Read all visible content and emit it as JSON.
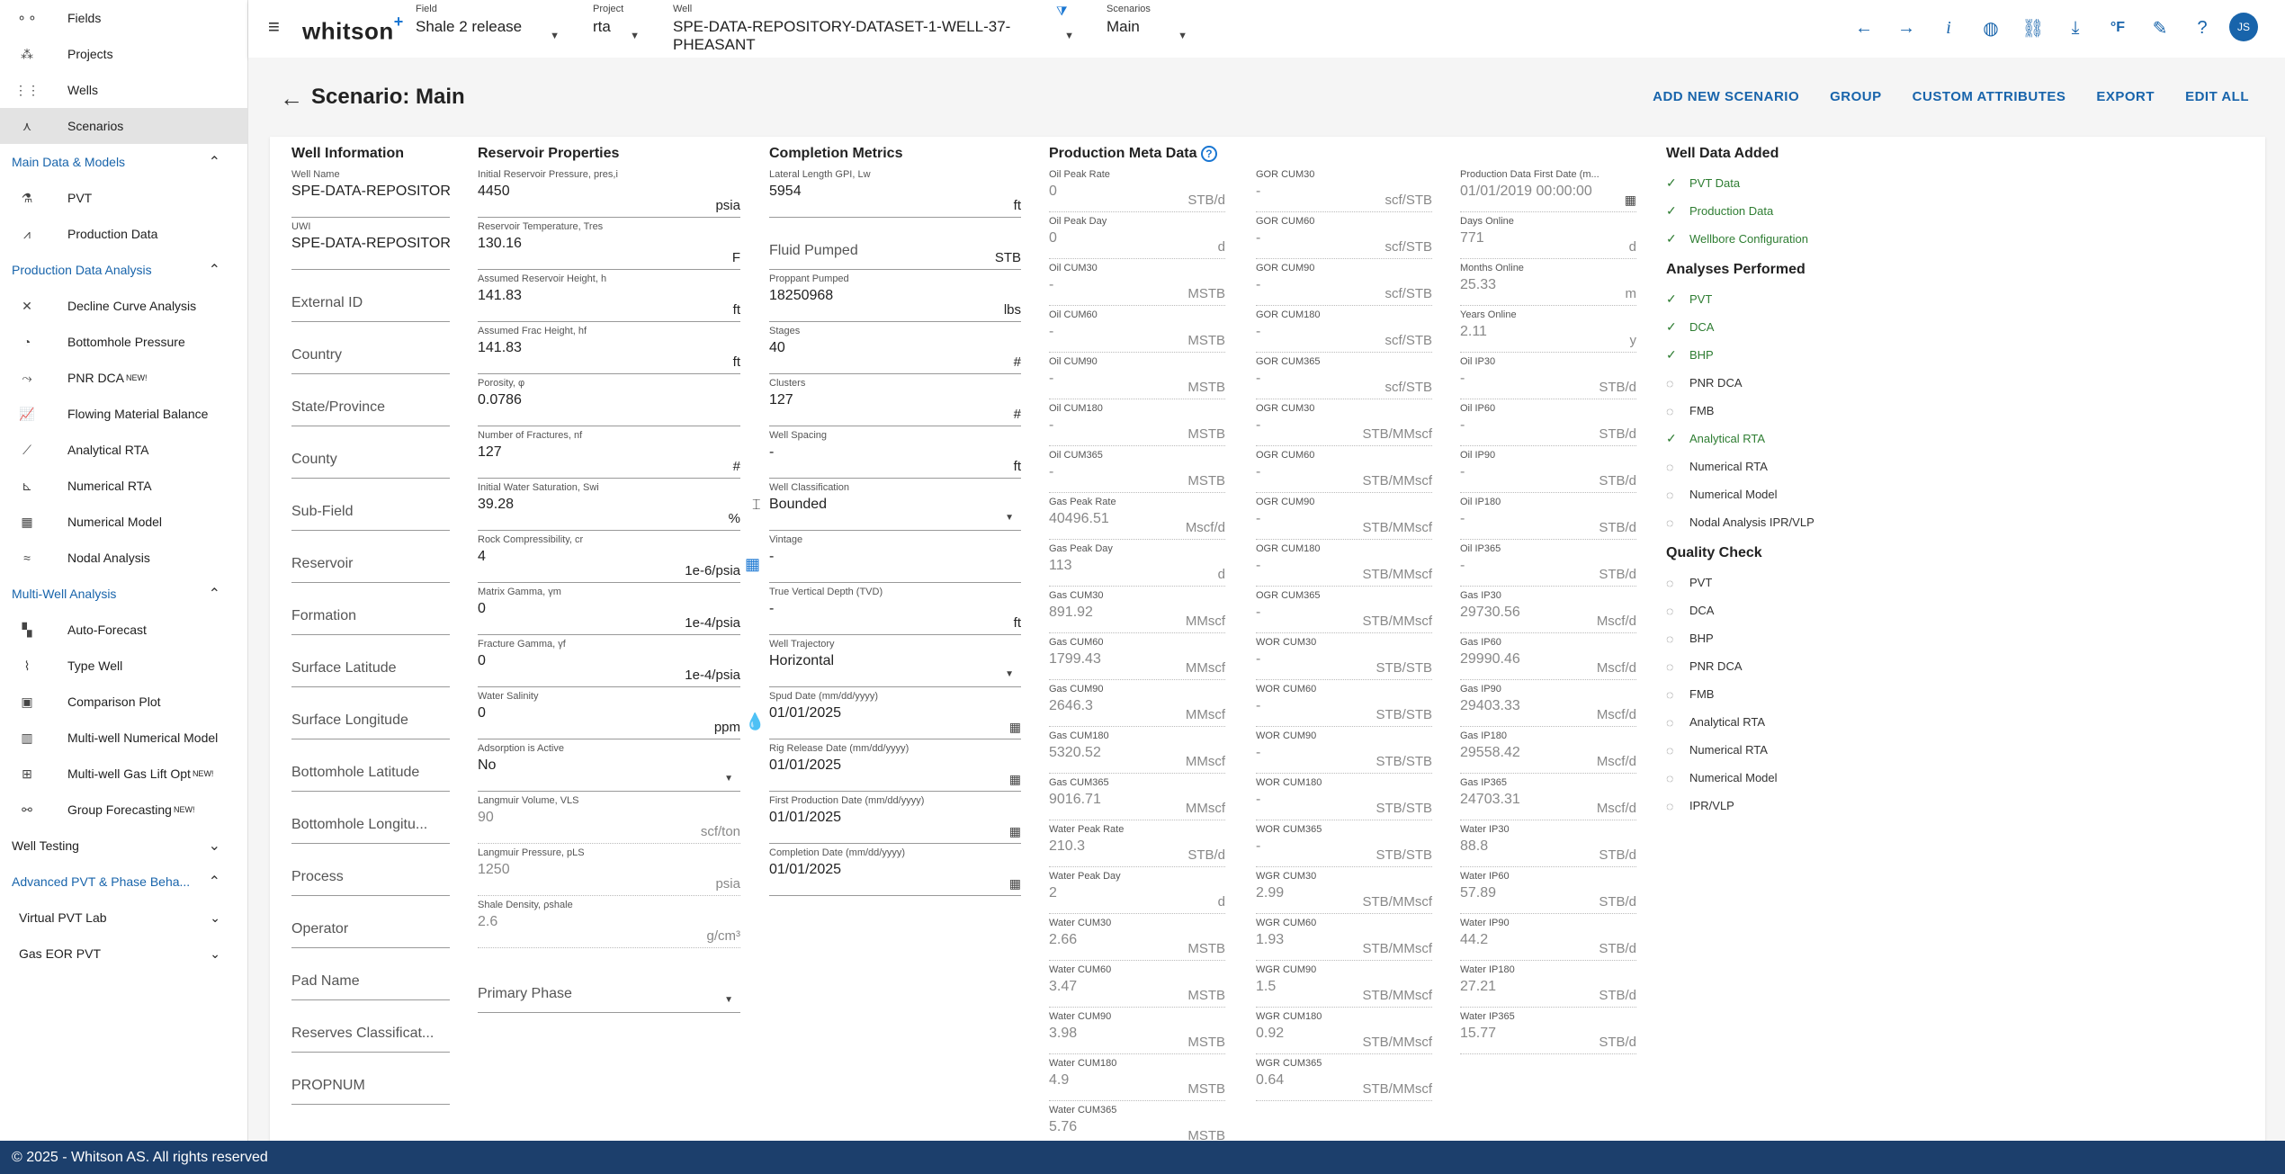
{
  "sidebar": {
    "items": [
      {
        "label": "Fields",
        "icon": "fields-icon",
        "active": false
      },
      {
        "label": "Projects",
        "icon": "projects-icon",
        "active": false
      },
      {
        "label": "Wells",
        "icon": "wells-icon",
        "active": false
      },
      {
        "label": "Scenarios",
        "icon": "scenarios-icon",
        "active": true
      }
    ],
    "sections": [
      {
        "label": "Main Data & Models",
        "items": [
          {
            "label": "PVT",
            "icon": "flask-icon"
          },
          {
            "label": "Production Data",
            "icon": "production-chart-icon"
          }
        ]
      },
      {
        "label": "Production Data Analysis",
        "items": [
          {
            "label": "Decline Curve Analysis",
            "icon": "decline-curve-icon"
          },
          {
            "label": "Bottomhole Pressure",
            "icon": "gauge-icon"
          },
          {
            "label": "PNR DCA",
            "sup": "NEW!",
            "icon": "pnr-dca-icon"
          },
          {
            "label": "Flowing Material Balance",
            "icon": "fmb-chart-icon"
          },
          {
            "label": "Analytical RTA",
            "icon": "analytical-rta-icon"
          },
          {
            "label": "Numerical RTA",
            "icon": "numerical-rta-icon"
          },
          {
            "label": "Numerical Model",
            "icon": "grid-model-icon"
          },
          {
            "label": "Nodal Analysis",
            "icon": "nodal-icon"
          }
        ]
      },
      {
        "label": "Multi-Well Analysis",
        "items": [
          {
            "label": "Auto-Forecast",
            "icon": "auto-forecast-icon"
          },
          {
            "label": "Type Well",
            "icon": "type-well-icon"
          },
          {
            "label": "Comparison Plot",
            "icon": "comparison-plot-icon"
          },
          {
            "label": "Multi-well Numerical Model",
            "icon": "multiwell-model-icon"
          },
          {
            "label": "Multi-well Gas Lift Opt",
            "sup": "NEW!",
            "icon": "gas-lift-icon"
          },
          {
            "label": "Group Forecasting",
            "sup": "NEW!",
            "icon": "group-forecast-icon"
          }
        ]
      }
    ],
    "well_testing": "Well Testing",
    "advanced": "Advanced PVT & Phase Beha...",
    "virtual_pvt": "Virtual PVT Lab",
    "gas_eor": "Gas EOR PVT"
  },
  "footer": "© 2025 - Whitson AS. All rights reserved",
  "topbar": {
    "brand": "whitson",
    "brand_plus": "+",
    "field": {
      "label": "Field",
      "value": "Shale 2 release"
    },
    "project": {
      "label": "Project",
      "value": "rta"
    },
    "well": {
      "label": "Well",
      "value": "SPE-DATA-REPOSITORY-DATASET-1-WELL-37-PHEASANT"
    },
    "scenarios": {
      "label": "Scenarios",
      "value": "Main"
    },
    "avatar": "JS"
  },
  "page": {
    "title": "Scenario: Main",
    "actions": [
      "ADD NEW SCENARIO",
      "GROUP",
      "CUSTOM ATTRIBUTES",
      "EXPORT",
      "EDIT ALL"
    ]
  },
  "well_info": {
    "title": "Well Information",
    "fields": [
      {
        "label": "Well Name",
        "value": "SPE-DATA-REPOSITORY-"
      },
      {
        "label": "UWI",
        "value": "SPE-DATA-REPOSITORY-"
      },
      {
        "label": "",
        "value": "External ID"
      },
      {
        "label": "",
        "value": "Country"
      },
      {
        "label": "",
        "value": "State/Province"
      },
      {
        "label": "",
        "value": "County"
      },
      {
        "label": "",
        "value": "Sub-Field"
      },
      {
        "label": "",
        "value": "Reservoir"
      },
      {
        "label": "",
        "value": "Formation"
      },
      {
        "label": "",
        "value": "Surface Latitude"
      },
      {
        "label": "",
        "value": "Surface Longitude"
      },
      {
        "label": "",
        "value": "Bottomhole Latitude"
      },
      {
        "label": "",
        "value": "Bottomhole Longitu..."
      },
      {
        "label": "",
        "value": "Process"
      },
      {
        "label": "",
        "value": "Operator"
      },
      {
        "label": "",
        "value": "Pad Name"
      },
      {
        "label": "",
        "value": "Reserves Classificat..."
      },
      {
        "label": "",
        "value": "PROPNUM"
      }
    ]
  },
  "reservoir": {
    "title": "Reservoir Properties",
    "fields": [
      {
        "label": "Initial Reservoir Pressure, pres,i",
        "value": "4450",
        "unit": "psia"
      },
      {
        "label": "Reservoir Temperature, Tres",
        "value": "130.16",
        "unit": "F"
      },
      {
        "label": "Assumed Reservoir Height, h",
        "value": "141.83",
        "unit": "ft"
      },
      {
        "label": "Assumed Frac Height, hf",
        "value": "141.83",
        "unit": "ft"
      },
      {
        "label": "Porosity, φ",
        "value": "0.0786",
        "unit": ""
      },
      {
        "label": "Number of Fractures, nf",
        "value": "127",
        "unit": "#"
      },
      {
        "label": "Initial Water Saturation, Swi",
        "value": "39.28",
        "unit": "%"
      },
      {
        "label": "Rock Compressibility, cr",
        "value": "4",
        "unit": "1e-6/psia"
      },
      {
        "label": "Matrix Gamma, γm",
        "value": "0",
        "unit": "1e-4/psia"
      },
      {
        "label": "Fracture Gamma, γf",
        "value": "0",
        "unit": "1e-4/psia"
      },
      {
        "label": "Water Salinity",
        "value": "0",
        "unit": "ppm"
      },
      {
        "label": "Adsorption is Active",
        "value": "No",
        "unit": ""
      },
      {
        "label": "Langmuir Volume, VLS",
        "value": "90",
        "unit": "scf/ton"
      },
      {
        "label": "Langmuir Pressure, pLS",
        "value": "1250",
        "unit": "psia"
      },
      {
        "label": "Shale Density, ρshale",
        "value": "2.6",
        "unit": "g/cm³"
      },
      {
        "label": "",
        "value": "Primary Phase",
        "unit": ""
      }
    ]
  },
  "completion": {
    "title": "Completion Metrics",
    "fields": [
      {
        "label": "Lateral Length GPI, Lw",
        "value": "5954",
        "unit": "ft"
      },
      {
        "label": "",
        "value": "Fluid Pumped",
        "unit": "STB"
      },
      {
        "label": "Proppant Pumped",
        "value": "18250968",
        "unit": "lbs"
      },
      {
        "label": "Stages",
        "value": "40",
        "unit": "#"
      },
      {
        "label": "Clusters",
        "value": "127",
        "unit": "#"
      },
      {
        "label": "Well Spacing",
        "value": "-",
        "unit": "ft"
      },
      {
        "label": "Well Classification",
        "value": "Bounded",
        "unit": ""
      },
      {
        "label": "Vintage",
        "value": "-",
        "unit": ""
      },
      {
        "label": "True Vertical Depth (TVD)",
        "value": "-",
        "unit": "ft"
      },
      {
        "label": "Well Trajectory",
        "value": "Horizontal",
        "unit": ""
      },
      {
        "label": "Spud Date (mm/dd/yyyy)",
        "value": "01/01/2025",
        "unit": ""
      },
      {
        "label": "Rig Release Date (mm/dd/yyyy)",
        "value": "01/01/2025",
        "unit": ""
      },
      {
        "label": "First Production Date (mm/dd/yyyy)",
        "value": "01/01/2025",
        "unit": ""
      },
      {
        "label": "Completion Date (mm/dd/yyyy)",
        "value": "01/01/2025",
        "unit": ""
      }
    ]
  },
  "production_meta": {
    "title": "Production Meta Data",
    "col1": [
      {
        "label": "Oil Peak Rate",
        "value": "0",
        "unit": "STB/d"
      },
      {
        "label": "Oil Peak Day",
        "value": "0",
        "unit": "d"
      },
      {
        "label": "Oil CUM30",
        "value": "-",
        "unit": "MSTB"
      },
      {
        "label": "Oil CUM60",
        "value": "-",
        "unit": "MSTB"
      },
      {
        "label": "Oil CUM90",
        "value": "-",
        "unit": "MSTB"
      },
      {
        "label": "Oil CUM180",
        "value": "-",
        "unit": "MSTB"
      },
      {
        "label": "Oil CUM365",
        "value": "-",
        "unit": "MSTB"
      },
      {
        "label": "Gas Peak Rate",
        "value": "40496.51",
        "unit": "Mscf/d"
      },
      {
        "label": "Gas Peak Day",
        "value": "113",
        "unit": "d"
      },
      {
        "label": "Gas CUM30",
        "value": "891.92",
        "unit": "MMscf"
      },
      {
        "label": "Gas CUM60",
        "value": "1799.43",
        "unit": "MMscf"
      },
      {
        "label": "Gas CUM90",
        "value": "2646.3",
        "unit": "MMscf"
      },
      {
        "label": "Gas CUM180",
        "value": "5320.52",
        "unit": "MMscf"
      },
      {
        "label": "Gas CUM365",
        "value": "9016.71",
        "unit": "MMscf"
      },
      {
        "label": "Water Peak Rate",
        "value": "210.3",
        "unit": "STB/d"
      },
      {
        "label": "Water Peak Day",
        "value": "2",
        "unit": "d"
      },
      {
        "label": "Water CUM30",
        "value": "2.66",
        "unit": "MSTB"
      },
      {
        "label": "Water CUM60",
        "value": "3.47",
        "unit": "MSTB"
      },
      {
        "label": "Water CUM90",
        "value": "3.98",
        "unit": "MSTB"
      },
      {
        "label": "Water CUM180",
        "value": "4.9",
        "unit": "MSTB"
      },
      {
        "label": "Water CUM365",
        "value": "5.76",
        "unit": "MSTB"
      }
    ],
    "col2": [
      {
        "label": "GOR CUM30",
        "value": "-",
        "unit": "scf/STB"
      },
      {
        "label": "GOR CUM60",
        "value": "-",
        "unit": "scf/STB"
      },
      {
        "label": "GOR CUM90",
        "value": "-",
        "unit": "scf/STB"
      },
      {
        "label": "GOR CUM180",
        "value": "-",
        "unit": "scf/STB"
      },
      {
        "label": "GOR CUM365",
        "value": "-",
        "unit": "scf/STB"
      },
      {
        "label": "OGR CUM30",
        "value": "-",
        "unit": "STB/MMscf"
      },
      {
        "label": "OGR CUM60",
        "value": "-",
        "unit": "STB/MMscf"
      },
      {
        "label": "OGR CUM90",
        "value": "-",
        "unit": "STB/MMscf"
      },
      {
        "label": "OGR CUM180",
        "value": "-",
        "unit": "STB/MMscf"
      },
      {
        "label": "OGR CUM365",
        "value": "-",
        "unit": "STB/MMscf"
      },
      {
        "label": "WOR CUM30",
        "value": "-",
        "unit": "STB/STB"
      },
      {
        "label": "WOR CUM60",
        "value": "-",
        "unit": "STB/STB"
      },
      {
        "label": "WOR CUM90",
        "value": "-",
        "unit": "STB/STB"
      },
      {
        "label": "WOR CUM180",
        "value": "-",
        "unit": "STB/STB"
      },
      {
        "label": "WOR CUM365",
        "value": "-",
        "unit": "STB/STB"
      },
      {
        "label": "WGR CUM30",
        "value": "2.99",
        "unit": "STB/MMscf"
      },
      {
        "label": "WGR CUM60",
        "value": "1.93",
        "unit": "STB/MMscf"
      },
      {
        "label": "WGR CUM90",
        "value": "1.5",
        "unit": "STB/MMscf"
      },
      {
        "label": "WGR CUM180",
        "value": "0.92",
        "unit": "STB/MMscf"
      },
      {
        "label": "WGR CUM365",
        "value": "0.64",
        "unit": "STB/MMscf"
      }
    ],
    "col3": [
      {
        "label": "Production Data First Date (m...",
        "value": "01/01/2019 00:00:00",
        "unit": ""
      },
      {
        "label": "Days Online",
        "value": "771",
        "unit": "d"
      },
      {
        "label": "Months Online",
        "value": "25.33",
        "unit": "m"
      },
      {
        "label": "Years Online",
        "value": "2.11",
        "unit": "y"
      },
      {
        "label": "Oil IP30",
        "value": "-",
        "unit": "STB/d"
      },
      {
        "label": "Oil IP60",
        "value": "-",
        "unit": "STB/d"
      },
      {
        "label": "Oil IP90",
        "value": "-",
        "unit": "STB/d"
      },
      {
        "label": "Oil IP180",
        "value": "-",
        "unit": "STB/d"
      },
      {
        "label": "Oil IP365",
        "value": "-",
        "unit": "STB/d"
      },
      {
        "label": "Gas IP30",
        "value": "29730.56",
        "unit": "Mscf/d"
      },
      {
        "label": "Gas IP60",
        "value": "29990.46",
        "unit": "Mscf/d"
      },
      {
        "label": "Gas IP90",
        "value": "29403.33",
        "unit": "Mscf/d"
      },
      {
        "label": "Gas IP180",
        "value": "29558.42",
        "unit": "Mscf/d"
      },
      {
        "label": "Gas IP365",
        "value": "24703.31",
        "unit": "Mscf/d"
      },
      {
        "label": "Water IP30",
        "value": "88.8",
        "unit": "STB/d"
      },
      {
        "label": "Water IP60",
        "value": "57.89",
        "unit": "STB/d"
      },
      {
        "label": "Water IP90",
        "value": "44.2",
        "unit": "STB/d"
      },
      {
        "label": "Water IP180",
        "value": "27.21",
        "unit": "STB/d"
      },
      {
        "label": "Water IP365",
        "value": "15.77",
        "unit": "STB/d"
      }
    ]
  },
  "well_data_added": {
    "title": "Well Data Added",
    "items": [
      "PVT Data",
      "Production Data",
      "Wellbore Configuration"
    ]
  },
  "analyses": {
    "title": "Analyses Performed",
    "items": [
      {
        "label": "PVT",
        "done": true
      },
      {
        "label": "DCA",
        "done": true
      },
      {
        "label": "BHP",
        "done": true
      },
      {
        "label": "PNR DCA",
        "done": false
      },
      {
        "label": "FMB",
        "done": false
      },
      {
        "label": "Analytical RTA",
        "done": true
      },
      {
        "label": "Numerical RTA",
        "done": false
      },
      {
        "label": "Numerical Model",
        "done": false
      },
      {
        "label": "Nodal Analysis IPR/VLP",
        "done": false
      }
    ]
  },
  "quality": {
    "title": "Quality Check",
    "items": [
      "PVT",
      "DCA",
      "BHP",
      "PNR DCA",
      "FMB",
      "Analytical RTA",
      "Numerical RTA",
      "Numerical Model",
      "IPR/VLP"
    ]
  }
}
